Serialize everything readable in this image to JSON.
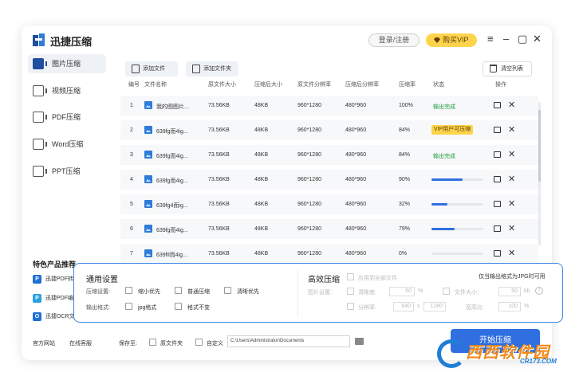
{
  "app": {
    "title": "迅捷压缩",
    "login_label": "登录/注册",
    "vip_label": "购买VIP"
  },
  "window_controls": {
    "menu": "≡",
    "minimize": "–",
    "maximize": "▢",
    "close": "✕"
  },
  "sidebar": {
    "items": [
      {
        "label": "图片压缩",
        "icon": "image-compress-icon",
        "active": true
      },
      {
        "label": "视频压缩",
        "icon": "video-compress-icon",
        "active": false
      },
      {
        "label": "PDF压缩",
        "icon": "pdf-compress-icon",
        "active": false
      },
      {
        "label": "Word压缩",
        "icon": "word-compress-icon",
        "active": false
      },
      {
        "label": "PPT压缩",
        "icon": "ppt-compress-icon",
        "active": false
      }
    ],
    "special_title": "特色产品推荐",
    "special_items": [
      {
        "label": "迅捷PDF转",
        "badge": "P",
        "color": "#1f6fd6"
      },
      {
        "label": "迅捷PDF编",
        "badge": "P",
        "color": "#28a0e0"
      },
      {
        "label": "迅捷OCR文",
        "badge": "O",
        "color": "#1f6fd6"
      }
    ]
  },
  "toolbar": {
    "add_file": "添加文件",
    "add_folder": "添加文件夹",
    "clear_list": "清空列表"
  },
  "table": {
    "headers": [
      "编号",
      "文件名称",
      "原文件大小",
      "压缩后大小",
      "原文件分辨率",
      "压缩后分辨率",
      "压缩率",
      "状态",
      "操作"
    ],
    "rows": [
      {
        "no": "1",
        "name": "我的图图片...",
        "orig_size": "73.56KB",
        "comp_size": "48KB",
        "orig_res": "960*1280",
        "comp_res": "480*960",
        "rate": "100%",
        "status_type": "done",
        "status": "输出完成",
        "progress": null
      },
      {
        "no": "2",
        "name": "639fg而4ig...",
        "orig_size": "73.56KB",
        "comp_size": "48KB",
        "orig_res": "960*1280",
        "comp_res": "480*960",
        "rate": "84%",
        "status_type": "vip",
        "status": "VIP用户可压缩",
        "progress": null
      },
      {
        "no": "3",
        "name": "639fg而4ig...",
        "orig_size": "73.56KB",
        "comp_size": "48KB",
        "orig_res": "960*1280",
        "comp_res": "480*960",
        "rate": "84%",
        "status_type": "done",
        "status": "输出完成",
        "progress": null
      },
      {
        "no": "4",
        "name": "639fg而4ig...",
        "orig_size": "73.56KB",
        "comp_size": "48KB",
        "orig_res": "960*1280",
        "comp_res": "480*960",
        "rate": "90%",
        "status_type": "progress",
        "status": "",
        "progress": 0.6
      },
      {
        "no": "5",
        "name": "639fg4而ig...",
        "orig_size": "73.56KB",
        "comp_size": "48KB",
        "orig_res": "960*1280",
        "comp_res": "480*960",
        "rate": "32%",
        "status_type": "progress",
        "status": "",
        "progress": 0.3
      },
      {
        "no": "6",
        "name": "639fg而4ig...",
        "orig_size": "73.56KB",
        "comp_size": "48KB",
        "orig_res": "960*1280",
        "comp_res": "480*960",
        "rate": "79%",
        "status_type": "progress",
        "status": "",
        "progress": 0.45
      },
      {
        "no": "7",
        "name": "639fil而4ig...",
        "orig_size": "73.56KB",
        "comp_size": "48KB",
        "orig_res": "960*1280",
        "comp_res": "480*960",
        "rate": "0%",
        "status_type": "progress",
        "status": "",
        "progress": 0
      }
    ]
  },
  "settings": {
    "general_title": "通用设置",
    "compress_label": "压缩设置:",
    "compress_options": [
      "缩小优先",
      "普通压缩",
      "清晰优先"
    ],
    "output_label": "输出格式:",
    "output_options": [
      "jpg格式",
      "格式不变"
    ],
    "advanced_title": "高效压缩",
    "apply_all": "应用到全部文件",
    "jpg_only_hint": "仅当输出格式为JPG时可用",
    "image_settings_label": "图片设置：",
    "clarity_label": "清晰度:",
    "clarity_value": "50",
    "clarity_unit": "%",
    "filesize_label": "文件大小：",
    "filesize_value": "50",
    "filesize_unit": "kb",
    "resolution_label": "分辨率:",
    "res_width": "640",
    "res_x": "x",
    "res_height": "1280",
    "ratio_label": "宽高比:",
    "ratio_value": "100",
    "ratio_unit": "%"
  },
  "footer": {
    "website": "官方网站",
    "online_service": "在线客服",
    "save_to": "保存至:",
    "orig_folder": "原文件夹",
    "custom": "自定义",
    "path": "C:\\Users\\Administrator\\Documents",
    "start_button": "开始压缩"
  },
  "watermark": {
    "brand": "西西软件园",
    "url": "CR173.COM"
  }
}
